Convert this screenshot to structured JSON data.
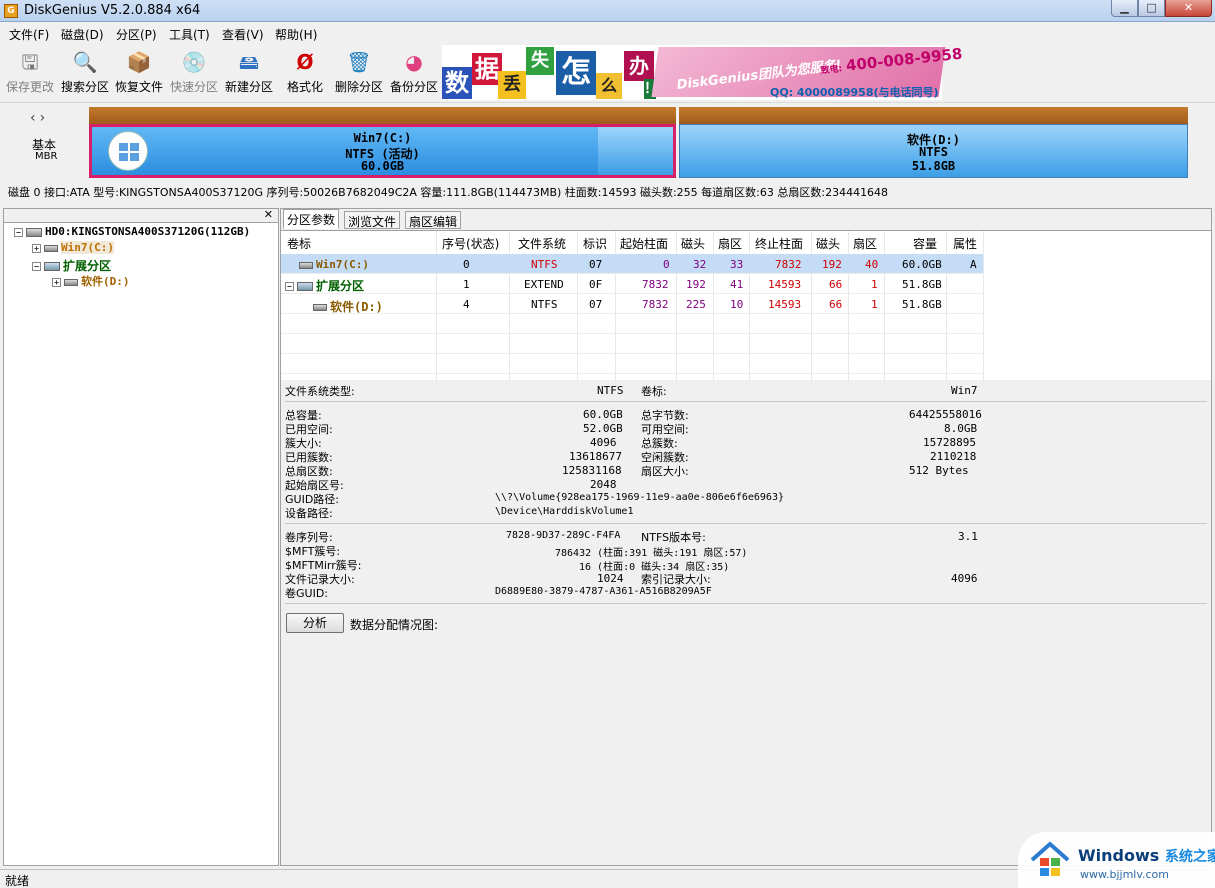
{
  "window": {
    "title": "DiskGenius V5.2.0.884 x64",
    "icon_letter": "G"
  },
  "menu": [
    "文件(F)",
    "磁盘(D)",
    "分区(P)",
    "工具(T)",
    "查看(V)",
    "帮助(H)"
  ],
  "toolbar": [
    {
      "label": "保存更改",
      "icon": "save-disk-icon",
      "enabled": false
    },
    {
      "label": "搜索分区",
      "icon": "magnifier-icon",
      "enabled": true
    },
    {
      "label": "恢复文件",
      "icon": "recover-box-icon",
      "enabled": true
    },
    {
      "label": "快速分区",
      "icon": "cd-disc-icon",
      "enabled": false
    },
    {
      "label": "新建分区",
      "icon": "new-partition-icon",
      "enabled": true
    },
    {
      "label": "格式化",
      "icon": "format-icon",
      "enabled": true
    },
    {
      "label": "删除分区",
      "icon": "trash-icon",
      "enabled": true
    },
    {
      "label": "备份分区",
      "icon": "backup-icon",
      "enabled": true
    }
  ],
  "banner": {
    "chars": [
      "数",
      "据",
      "丢",
      "失",
      "怎",
      "么",
      "办",
      "！"
    ],
    "team": "DiskGenius团队为您服务!",
    "phone": "400-008-9958",
    "phone_prefix": "致电:",
    "qq": "QQ: 4000089958(与电话同号)"
  },
  "disk_panel": {
    "type": "基本",
    "style": "MBR",
    "partitions": [
      {
        "name": "Win7(C:)",
        "fs": "NTFS (活动)",
        "size": "60.0GB"
      },
      {
        "name": "软件(D:)",
        "fs": "NTFS",
        "size": "51.8GB"
      }
    ]
  },
  "disk_info": "磁盘 0 接口:ATA  型号:KINGSTONSA400S37120G  序列号:50026B7682049C2A  容量:111.8GB(114473MB)  柱面数:14593  磁头数:255  每道扇区数:63  总扇区数:234441648",
  "tree": {
    "disk": "HD0:KINGSTONSA400S37120G(112GB)",
    "c": "Win7(C:)",
    "ext": "扩展分区",
    "d": "软件(D:)"
  },
  "tabs": [
    "分区参数",
    "浏览文件",
    "扇区编辑"
  ],
  "grid": {
    "headers": [
      "卷标",
      "序号(状态)",
      "文件系统",
      "标识",
      "起始柱面",
      "磁头",
      "扇区",
      "终止柱面",
      "磁头",
      "扇区",
      "容量",
      "属性"
    ],
    "rows": [
      [
        "Win7(C:)",
        "0",
        "NTFS",
        "07",
        "0",
        "32",
        "33",
        "7832",
        "192",
        "40",
        "60.0GB",
        "A"
      ],
      [
        "扩展分区",
        "1",
        "EXTEND",
        "0F",
        "7832",
        "192",
        "41",
        "14593",
        "66",
        "1",
        "51.8GB",
        ""
      ],
      [
        "软件(D:)",
        "4",
        "NTFS",
        "07",
        "7832",
        "225",
        "10",
        "14593",
        "66",
        "1",
        "51.8GB",
        ""
      ]
    ]
  },
  "details": {
    "fs_type_label": "文件系统类型:",
    "fs_type": "NTFS",
    "vol_label_label": "卷标:",
    "vol_label": "Win7",
    "total_label": "总容量:",
    "total": "60.0GB",
    "total_bytes_label": "总字节数:",
    "total_bytes": "64425558016",
    "used_label": "已用空间:",
    "used": "52.0GB",
    "free_label": "可用空间:",
    "free": "8.0GB",
    "cluster_label": "簇大小:",
    "cluster": "4096",
    "total_clusters_label": "总簇数:",
    "total_clusters": "15728895",
    "used_clusters_label": "已用簇数:",
    "used_clusters": "13618677",
    "free_clusters_label": "空闲簇数:",
    "free_clusters": "2110218",
    "total_sectors_label": "总扇区数:",
    "total_sectors": "125831168",
    "sector_size_label": "扇区大小:",
    "sector_size": "512 Bytes",
    "start_sector_label": "起始扇区号:",
    "start_sector": "2048",
    "guid_path_label": "GUID路径:",
    "guid_path": "\\\\?\\Volume{928ea175-1969-11e9-aa0e-806e6f6e6963}",
    "device_path_label": "设备路径:",
    "device_path": "\\Device\\HarddiskVolume1",
    "serial_label": "卷序列号:",
    "serial": "7828-9D37-289C-F4FA",
    "ntfs_ver_label": "NTFS版本号:",
    "ntfs_ver": "3.1",
    "mft_label": "$MFT簇号:",
    "mft": "786432 (柱面:391 磁头:191 扇区:57)",
    "mftmirr_label": "$MFTMirr簇号:",
    "mftmirr": "16 (柱面:0 磁头:34 扇区:35)",
    "record_size_label": "文件记录大小:",
    "record_size": "1024",
    "index_size_label": "索引记录大小:",
    "index_size": "4096",
    "vol_guid_label": "卷GUID:",
    "vol_guid": "D6889E80-3879-4787-A361-A516B8209A5F"
  },
  "analyze_button": "分析",
  "distribution_label": "数据分配情况图:",
  "status": "就绪",
  "watermark": {
    "brand": "Windows",
    "site": "系统之家",
    "url": "www.bjjmlv.com"
  }
}
